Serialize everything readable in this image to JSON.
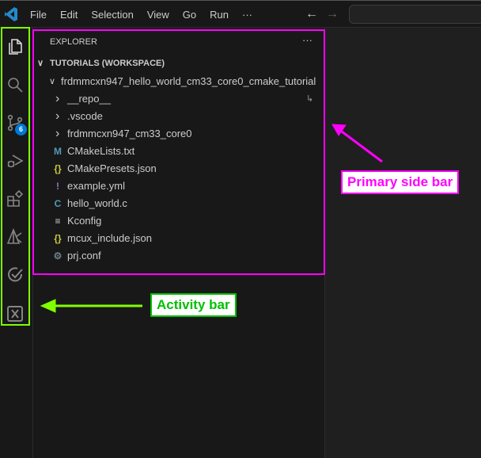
{
  "menu": [
    "File",
    "Edit",
    "Selection",
    "View",
    "Go",
    "Run",
    "···"
  ],
  "nav": {
    "back": "←",
    "forward": "→"
  },
  "activity": {
    "scm_badge": "6"
  },
  "sidebar": {
    "title": "EXPLORER",
    "more": "···",
    "workspace": "TUTORIALS (WORKSPACE)",
    "root": "frdmmcxn947_hello_world_cm33_core0_cmake_tutorial",
    "items": [
      {
        "label": "__repo__",
        "type": "folder",
        "icon": "",
        "color": ""
      },
      {
        "label": ".vscode",
        "type": "folder",
        "icon": "",
        "color": ""
      },
      {
        "label": "frdmmcxn947_cm33_core0",
        "type": "folder",
        "icon": "",
        "color": ""
      },
      {
        "label": "CMakeLists.txt",
        "type": "file",
        "icon": "M",
        "color": "#519aba"
      },
      {
        "label": "CMakePresets.json",
        "type": "file",
        "icon": "{}",
        "color": "#cbcb41"
      },
      {
        "label": "example.yml",
        "type": "file",
        "icon": "!",
        "color": "#a074c4"
      },
      {
        "label": "hello_world.c",
        "type": "file",
        "icon": "C",
        "color": "#519aba"
      },
      {
        "label": "Kconfig",
        "type": "file",
        "icon": "≡",
        "color": "#cccccc"
      },
      {
        "label": "mcux_include.json",
        "type": "file",
        "icon": "{}",
        "color": "#cbcb41"
      },
      {
        "label": "prj.conf",
        "type": "file",
        "icon": "⚙",
        "color": "#6d8086"
      }
    ],
    "symlink_icon": "↳"
  },
  "annotations": {
    "primary": "Primary side bar",
    "activity": "Activity bar",
    "primary_color": "#ff00ff",
    "activity_color": "#00c000"
  }
}
